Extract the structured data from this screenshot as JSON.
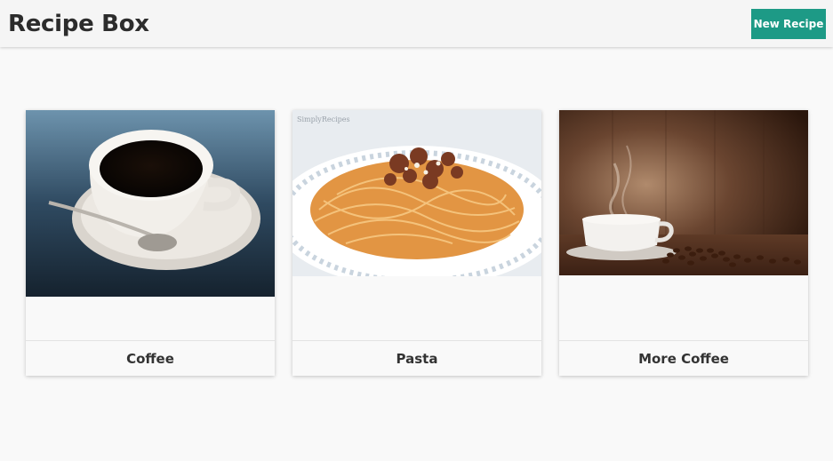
{
  "header": {
    "title": "Recipe Box",
    "new_recipe_label": "New Recipe",
    "accent_color": "#1d9a86"
  },
  "recipes": [
    {
      "name": "Coffee",
      "image_icon": "coffee-cup-photo"
    },
    {
      "name": "Pasta",
      "image_icon": "spaghetti-photo",
      "watermark": "SimplyRecipes"
    },
    {
      "name": "More Coffee",
      "image_icon": "coffee-beans-photo"
    }
  ]
}
